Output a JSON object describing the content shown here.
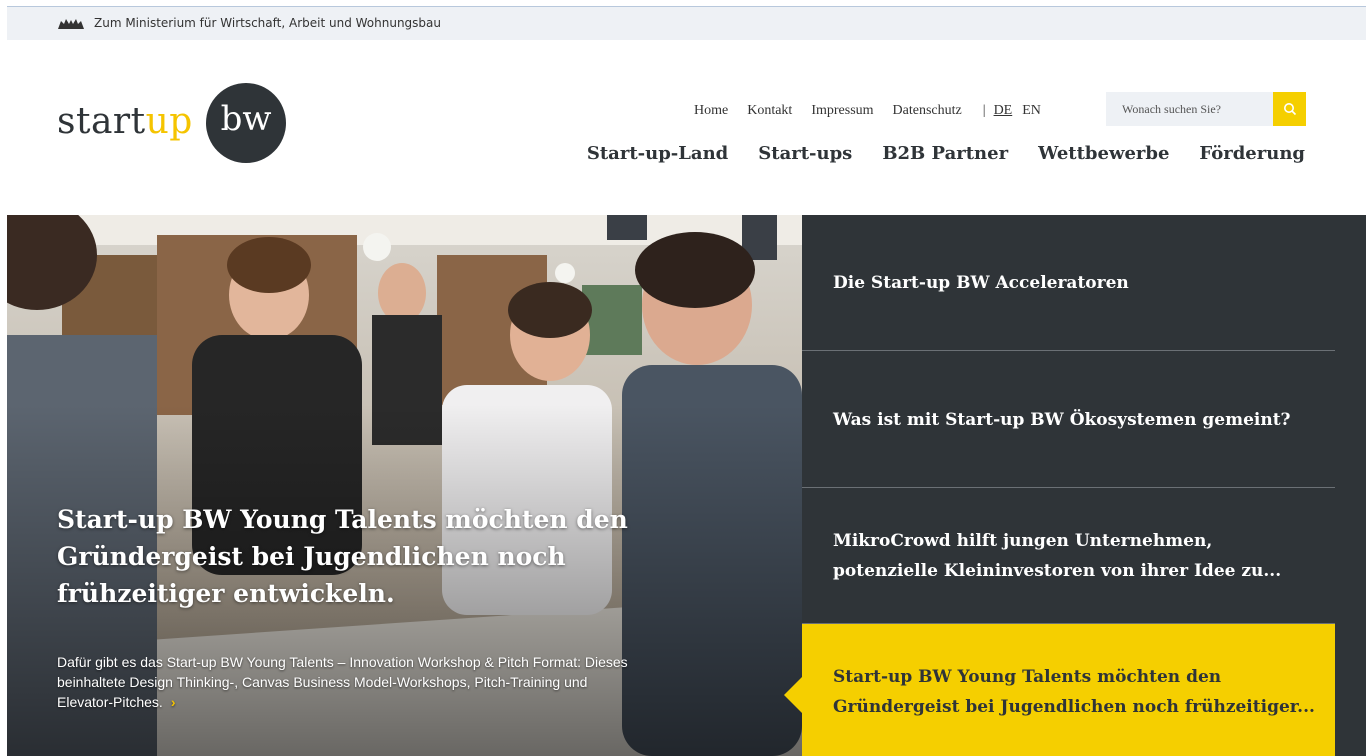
{
  "topbar": {
    "ministry_link": "Zum Ministerium für Wirtschaft, Arbeit und Wohnungsbau",
    "icon": "lion-crest-icon"
  },
  "logo": {
    "word_start": "start",
    "word_up": "up",
    "bw": "bw"
  },
  "service_nav": {
    "items": [
      "Home",
      "Kontakt",
      "Impressum",
      "Datenschutz"
    ],
    "separator": "|",
    "languages": [
      "DE",
      "EN"
    ],
    "active_language": "DE"
  },
  "search": {
    "placeholder": "Wonach suchen Sie?",
    "icon": "search-icon",
    "accent": "#f5cf00"
  },
  "main_nav": {
    "items": [
      "Start-up-Land",
      "Start-ups",
      "B2B Partner",
      "Wettbewerbe",
      "Förderung"
    ]
  },
  "hero": {
    "title": "Start-up BW Young Talents möchten den Gründergeist bei Jugendlichen noch frühzeitiger entwickeln.",
    "text": "Dafür gibt es das Start-up BW Young Talents – Innovation Workshop & Pitch Format: Dieses beinhaltete Design Thinking-, Canvas Business Model-Workshops, Pitch-Training und Elevator-Pitches.",
    "more_arrow": "›"
  },
  "teasers": [
    {
      "title": "Die Start-up BW Acceleratoren"
    },
    {
      "title": "Was ist mit Start-up BW Ökosystemen gemeint?"
    },
    {
      "title": "MikroCrowd hilft jungen Unternehmen, potenzielle Kleininvestoren von ihrer Idee zu..."
    },
    {
      "title": "Start-up BW Young Talents möchten den Gründergeist bei Jugendlichen noch frühzeitiger..."
    }
  ],
  "colors": {
    "brand_dark": "#2f3438",
    "brand_yellow": "#f5cf00",
    "topbar_bg": "#eef1f5"
  }
}
